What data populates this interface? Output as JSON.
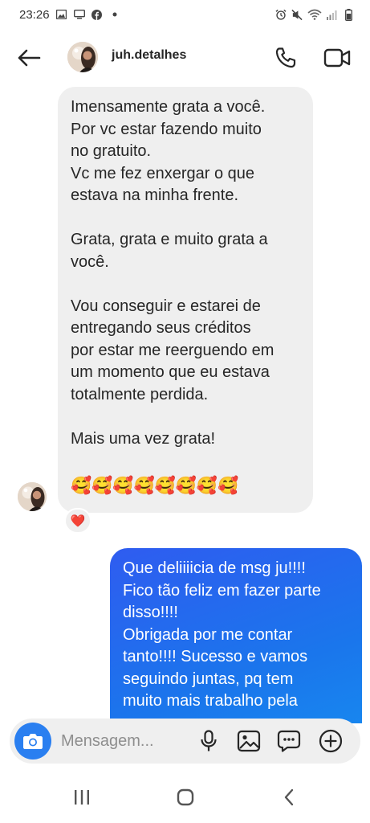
{
  "status_bar": {
    "time": "23:26",
    "left_icons": [
      "gallery-icon",
      "screen-icon",
      "facebook-icon",
      "dot-icon"
    ],
    "right_icons": [
      "alarm-icon",
      "mute-icon",
      "wifi-icon",
      "signal-icon",
      "battery-icon"
    ]
  },
  "header": {
    "username": "juh.detalhes",
    "icons": [
      "back-arrow-icon",
      "avatar",
      "phone-icon",
      "video-camera-icon"
    ]
  },
  "messages": {
    "incoming": {
      "lines": [
        "Imensamente grata a você.",
        "Por vc estar fazendo muito",
        "no gratuito.",
        "Vc me fez enxergar o que",
        "estava na minha frente.",
        "",
        "Grata, grata e muito grata a",
        "você.",
        "",
        "Vou conseguir e estarei de",
        "entregando seus créditos",
        "por estar me reerguendo em",
        "um momento que eu estava",
        "totalmente perdida.",
        "",
        "Mais uma vez grata!",
        ""
      ],
      "emojis": "🥰🥰🥰🥰🥰🥰🥰🥰",
      "reaction": "❤️"
    },
    "outgoing": {
      "lines": [
        "Que deliiiicia de msg ju!!!!",
        "Fico tão feliz em fazer parte",
        "disso!!!!",
        "Obrigada por me contar",
        "tanto!!!! Sucesso e vamos",
        "seguindo juntas, pq tem",
        "muito mais trabalho pela"
      ]
    }
  },
  "composer": {
    "placeholder": "Mensagem...",
    "icons": [
      "camera-icon",
      "microphone-icon",
      "image-icon",
      "sticker-icon",
      "plus-icon"
    ]
  },
  "nav_bar": {
    "icons": [
      "recents-icon",
      "home-icon",
      "back-icon"
    ]
  },
  "colors": {
    "incoming_bubble": "#efefef",
    "outgoing_bubble_start": "#2f5cf0",
    "outgoing_bubble_end": "#178cf0",
    "camera_button": "#2a7ff0",
    "text": "#262626",
    "placeholder": "#8e8e8e"
  }
}
